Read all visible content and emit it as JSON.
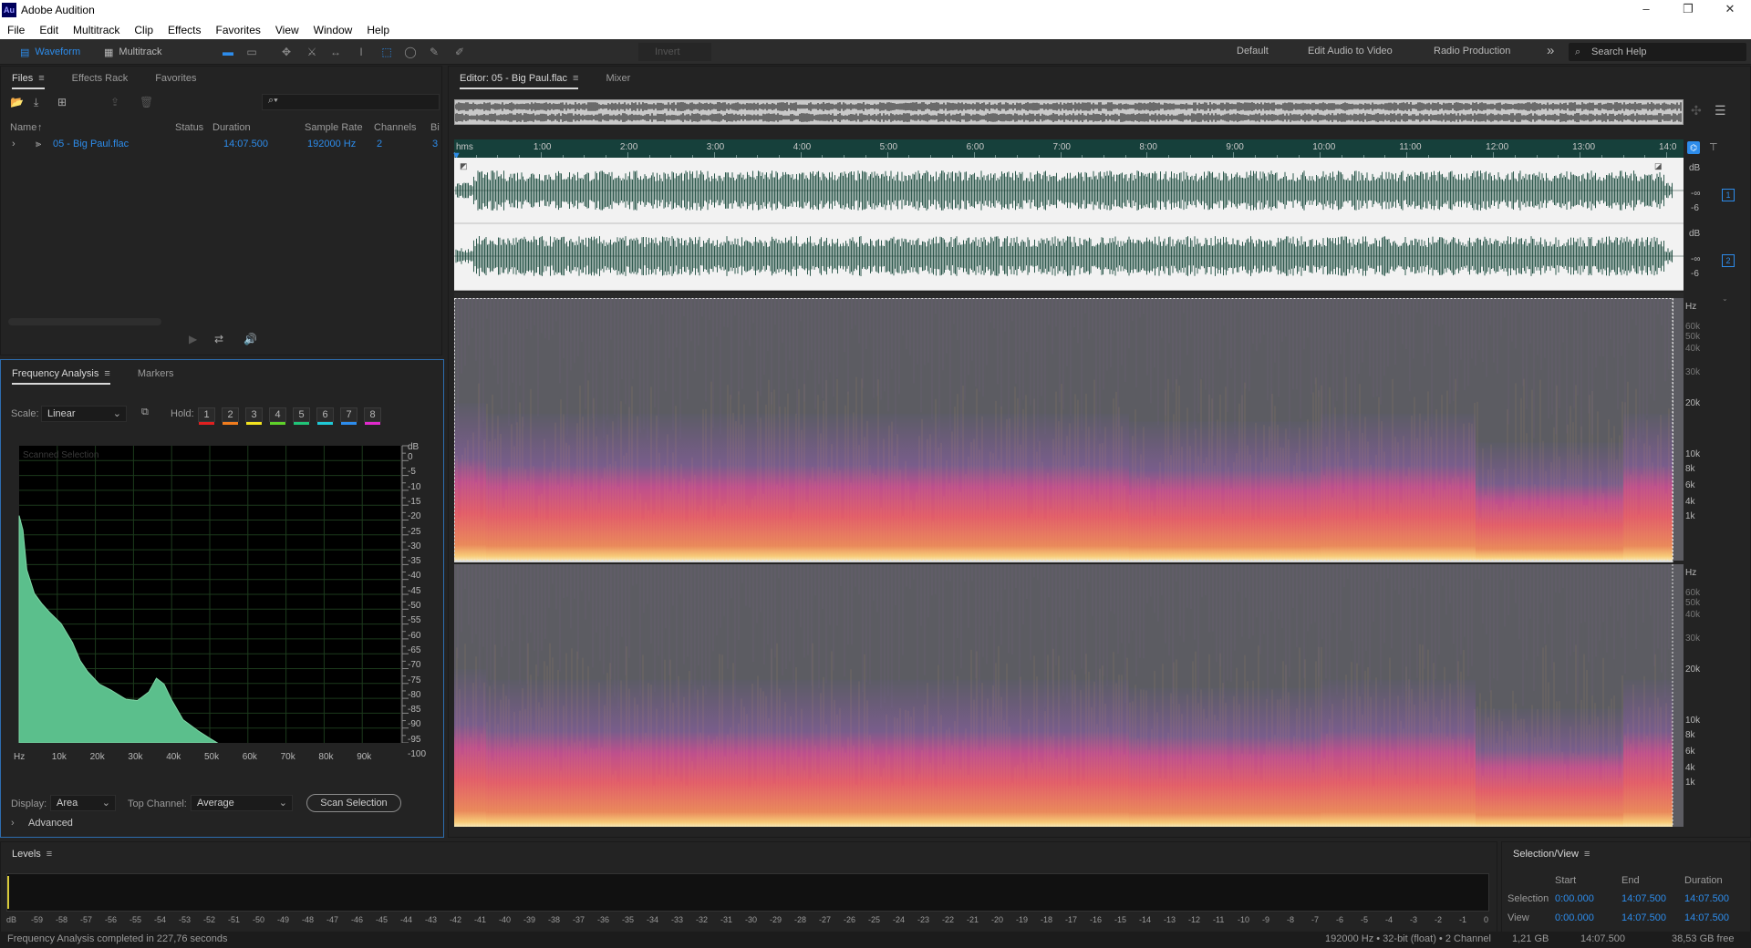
{
  "titlebar": {
    "icon": "Au",
    "title": "Adobe Audition",
    "minimize": "–",
    "restore": "❐",
    "close": "✕"
  },
  "menu": [
    "File",
    "Edit",
    "Multitrack",
    "Clip",
    "Effects",
    "Favorites",
    "View",
    "Window",
    "Help"
  ],
  "toolbar": {
    "waveform_label": "Waveform",
    "multitrack_label": "Multitrack",
    "invert_label": "Invert",
    "workspaces": [
      "Default",
      "Edit Audio to Video",
      "Radio Production"
    ],
    "overflow": "»",
    "search_placeholder": "Search Help"
  },
  "files_panel": {
    "tabs": [
      "Files",
      "Effects Rack",
      "Favorites"
    ],
    "columns": [
      "Name",
      "Status",
      "Duration",
      "Sample Rate",
      "Channels",
      "Bi"
    ],
    "rows": [
      {
        "name": "05 - Big Paul.flac",
        "status": "",
        "duration": "14:07.500",
        "sample_rate": "192000 Hz",
        "channels": "2",
        "bits": "3"
      }
    ]
  },
  "freq_panel": {
    "tabs": [
      "Frequency Analysis",
      "Markers"
    ],
    "scale_label": "Scale:",
    "scale_value": "Linear",
    "hold_label": "Hold:",
    "holds": [
      {
        "label": "1",
        "color": "#e02020"
      },
      {
        "label": "2",
        "color": "#f07c1e"
      },
      {
        "label": "3",
        "color": "#f2e21f"
      },
      {
        "label": "4",
        "color": "#5fd12a"
      },
      {
        "label": "5",
        "color": "#21c478"
      },
      {
        "label": "6",
        "color": "#1fc9d6"
      },
      {
        "label": "7",
        "color": "#2d8ceb"
      },
      {
        "label": "8",
        "color": "#e02acb"
      }
    ],
    "graph_caption": "Scanned Selection",
    "db_unit": "dB",
    "db_ticks": [
      "0",
      "-5",
      "-10",
      "-15",
      "-20",
      "-25",
      "-30",
      "-35",
      "-40",
      "-45",
      "-50",
      "-55",
      "-60",
      "-65",
      "-70",
      "-75",
      "-80",
      "-85",
      "-90",
      "-95",
      "-100"
    ],
    "hz_ticks": [
      "Hz",
      "10k",
      "20k",
      "30k",
      "40k",
      "50k",
      "60k",
      "70k",
      "80k",
      "90k"
    ],
    "display_label": "Display:",
    "display_value": "Area",
    "top_channel_label": "Top Channel:",
    "top_channel_value": "Average",
    "scan_button": "Scan Selection",
    "advanced_label": "Advanced",
    "fill_color": "#5bbf8c"
  },
  "editor": {
    "tabs": [
      "Editor: 05 - Big Paul.flac",
      "Mixer"
    ],
    "time_ticks": [
      "hms",
      "1:00",
      "2:00",
      "3:00",
      "4:00",
      "5:00",
      "6:00",
      "7:00",
      "8:00",
      "9:00",
      "10:00",
      "11:00",
      "12:00",
      "13:00",
      "14:0"
    ],
    "channel_1": {
      "db_unit": "dB",
      "db_labels": [
        "-∞",
        "-6"
      ],
      "channel_badge": "1"
    },
    "channel_2": {
      "db_unit": "dB",
      "db_labels": [
        "-∞",
        "-6"
      ],
      "channel_badge": "2"
    },
    "spectral_hz_labels": [
      "Hz",
      "60k",
      "50k",
      "40k",
      "30k",
      "20k",
      "10k",
      "8k",
      "6k",
      "4k",
      "1k"
    ],
    "waveform_color": "#2f5a4e"
  },
  "levels_panel": {
    "title": "Levels",
    "ticks": [
      "dB",
      "-59",
      "-58",
      "-57",
      "-56",
      "-55",
      "-54",
      "-53",
      "-52",
      "-51",
      "-50",
      "-49",
      "-48",
      "-47",
      "-46",
      "-45",
      "-44",
      "-43",
      "-42",
      "-41",
      "-40",
      "-39",
      "-38",
      "-37",
      "-36",
      "-35",
      "-34",
      "-33",
      "-32",
      "-31",
      "-30",
      "-29",
      "-28",
      "-27",
      "-26",
      "-25",
      "-24",
      "-23",
      "-22",
      "-21",
      "-20",
      "-19",
      "-18",
      "-17",
      "-16",
      "-15",
      "-14",
      "-13",
      "-12",
      "-11",
      "-10",
      "-9",
      "-8",
      "-7",
      "-6",
      "-5",
      "-4",
      "-3",
      "-2",
      "-1",
      "0"
    ]
  },
  "selection_view": {
    "title": "Selection/View",
    "headers": [
      "Start",
      "End",
      "Duration"
    ],
    "selection_label": "Selection",
    "view_label": "View",
    "selection": {
      "start": "0:00.000",
      "end": "14:07.500",
      "duration": "14:07.500"
    },
    "view": {
      "start": "0:00.000",
      "end": "14:07.500",
      "duration": "14:07.500"
    }
  },
  "status": {
    "message": "Frequency Analysis completed in 227,76 seconds",
    "format": "192000 Hz • 32-bit (float) • 2 Channel",
    "size": "1,21 GB",
    "duration": "14:07.500",
    "free": "38,53 GB free"
  }
}
